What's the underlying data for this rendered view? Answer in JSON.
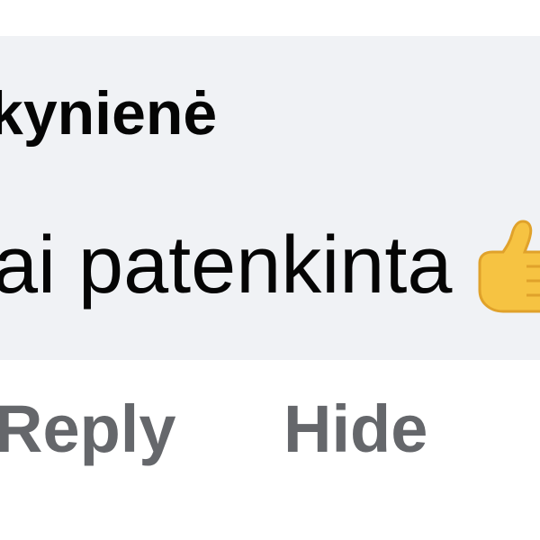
{
  "comment": {
    "author": "kynienė",
    "text": "ai patenkinta",
    "emoji": "thumbs-up-icon"
  },
  "actions": {
    "reply_label": "Reply",
    "hide_label": "Hide"
  },
  "colors": {
    "bubble_bg": "#f0f2f5",
    "text": "#050505",
    "action_text": "#65676b",
    "thumb_fill": "#f6c342",
    "thumb_shade": "#e0a22b"
  }
}
